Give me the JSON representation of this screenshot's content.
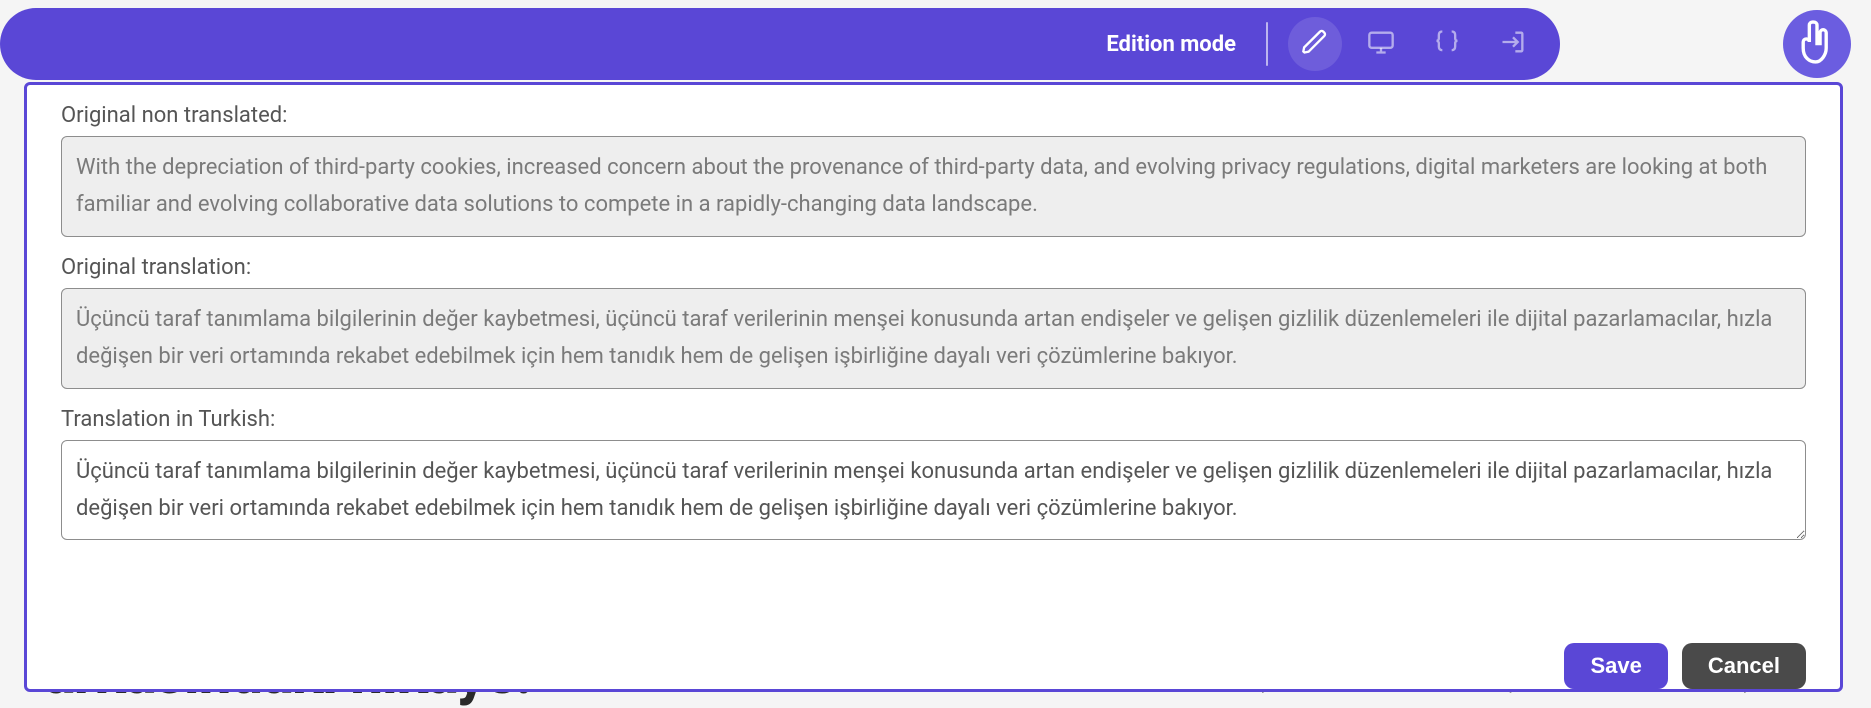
{
  "topbar": {
    "mode_label": "Edition mode"
  },
  "modal": {
    "label_original": "Original non translated:",
    "value_original": "With the depreciation of third-party cookies, increased concern about the provenance of third-party data, and evolving privacy regulations, digital marketers are looking at both familiar and evolving collaborative data solutions to compete in a rapidly-changing data landscape.",
    "label_translation_orig": "Original translation:",
    "value_translation_orig": "Üçüncü taraf tanımlama bilgilerinin değer kaybetmesi, üçüncü taraf verilerinin menşei konusunda artan endişeler ve gelişen gizlilik düzenlemeleri ile dijital pazarlamacılar, hızla değişen bir veri ortamında rekabet edebilmek için hem tanıdık hem de gelişen işbirliğine dayalı veri çözümlerine bakıyor.",
    "label_translation_new": "Translation in Turkish:",
    "value_translation_new": "Üçüncü taraf tanımlama bilgilerinin değer kaybetmesi, üçüncü taraf verilerinin menşei konusunda artan endişeler ve gelişen gizlilik düzenlemeleri ile dijital pazarlamacılar, hızla değişen bir veri ortamında rekabet edebilmek için hem tanıdık hem de gelişen işbirliğine dayalı veri çözümlerine bakıyor.",
    "save_label": "Save",
    "cancel_label": "Cancel"
  },
  "background": {
    "headline_fragment": "arkasındaki hikaye.",
    "right_fragment": "üçüncü taraf verilerinin menşei konusunda artan endişeler ve"
  }
}
